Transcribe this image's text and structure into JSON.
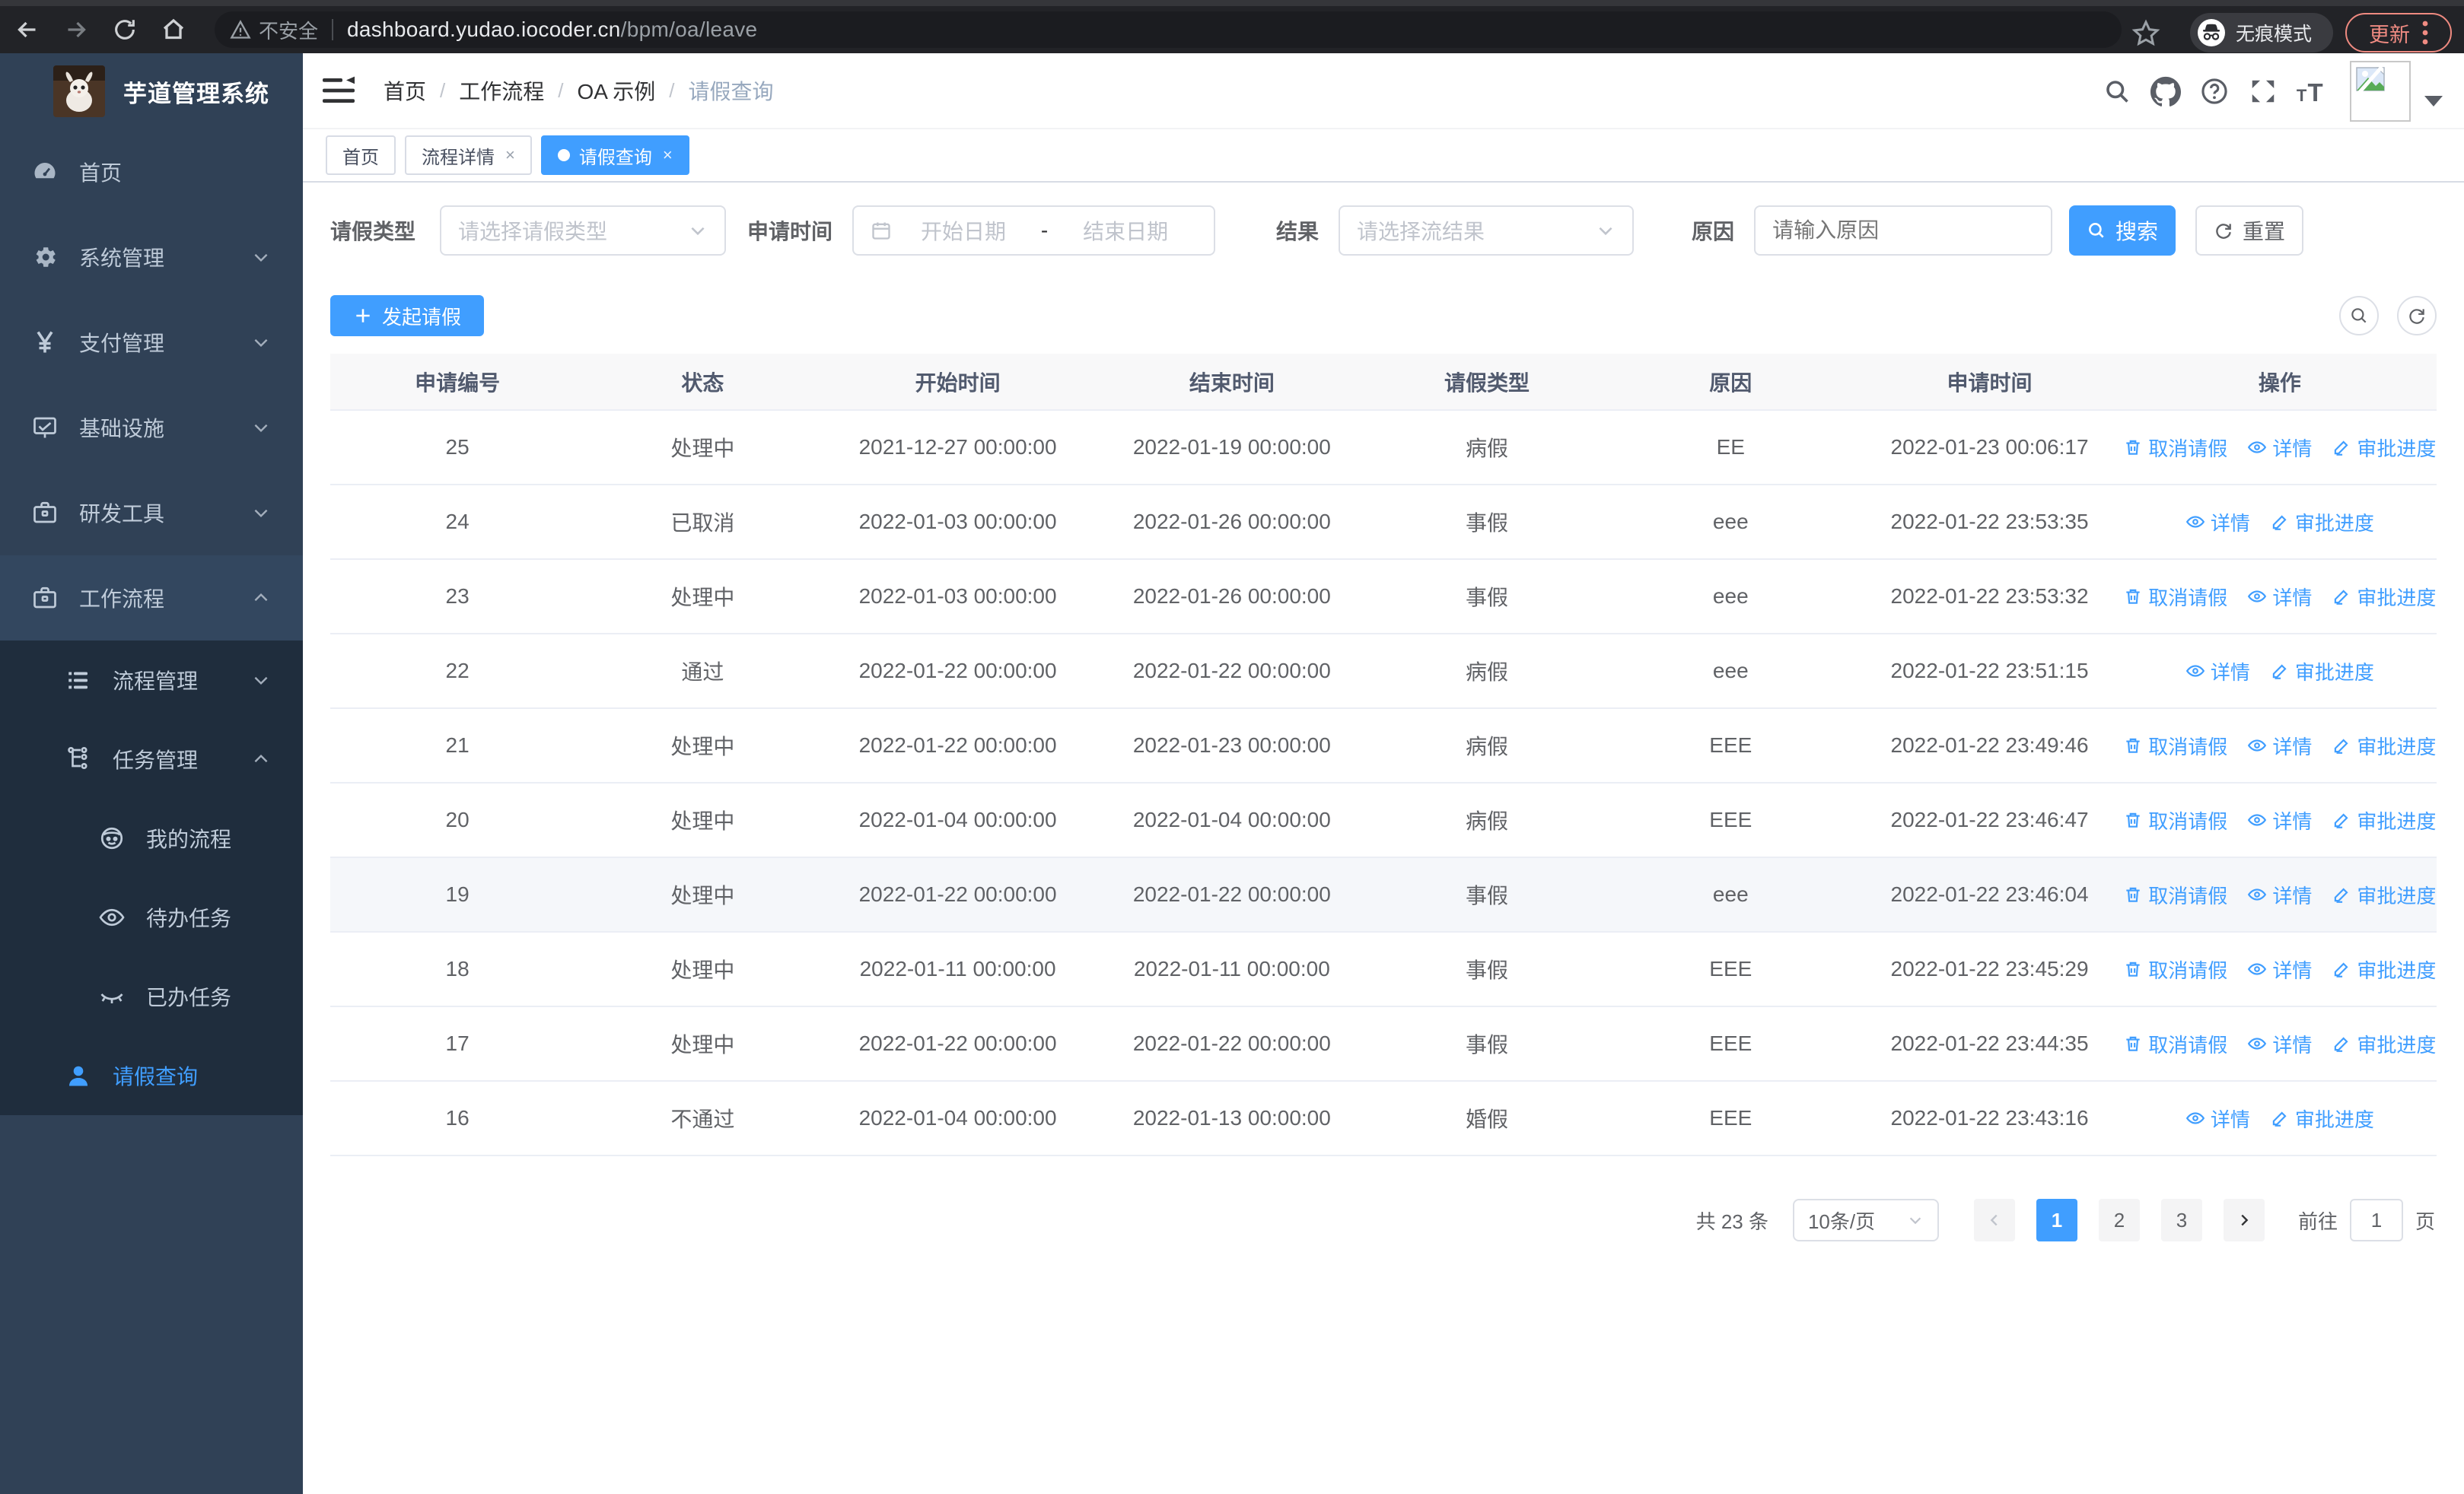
{
  "browser": {
    "security_label": "不安全",
    "url_domain": "dashboard.yudao.iocoder.cn",
    "url_path": "/bpm/oa/leave",
    "incognito_label": "无痕模式",
    "update_label": "更新"
  },
  "colors": {
    "accent": "#409eff",
    "sidebar_bg": "#304156",
    "submenu_bg": "#1f2d3d",
    "update_red": "#f08b82"
  },
  "sidebar": {
    "title": "芋道管理系统",
    "items": [
      {
        "name": "home",
        "icon": "dashboard-icon",
        "label": "首页",
        "level": 1
      },
      {
        "name": "system-management",
        "icon": "gear-icon",
        "label": "系统管理",
        "level": 1,
        "chevron": "down"
      },
      {
        "name": "payment-management",
        "icon": "yen-icon",
        "label": "支付管理",
        "level": 1,
        "chevron": "down"
      },
      {
        "name": "infrastructure",
        "icon": "monitor-icon",
        "label": "基础设施",
        "level": 1,
        "chevron": "down"
      },
      {
        "name": "dev-tools",
        "icon": "briefcase-icon",
        "label": "研发工具",
        "level": 1,
        "chevron": "down"
      },
      {
        "name": "workflow",
        "icon": "briefcase-icon",
        "label": "工作流程",
        "level": 1,
        "chevron": "up",
        "hovered": true
      },
      {
        "name": "process-management",
        "icon": "list-icon",
        "label": "流程管理",
        "level": 2,
        "chevron": "down",
        "dark": true
      },
      {
        "name": "task-management",
        "icon": "tree-icon",
        "label": "任务管理",
        "level": 2,
        "chevron": "up",
        "dark": true
      },
      {
        "name": "my-process",
        "icon": "robot-icon",
        "label": "我的流程",
        "level": 3,
        "dark": true
      },
      {
        "name": "todo-tasks",
        "icon": "eye-icon",
        "label": "待办任务",
        "level": 3,
        "dark": true
      },
      {
        "name": "done-tasks",
        "icon": "eye-closed-icon",
        "label": "已办任务",
        "level": 3,
        "dark": true
      },
      {
        "name": "leave-query",
        "icon": "user-icon",
        "label": "请假查询",
        "level": 2,
        "dark": true,
        "active": true
      }
    ]
  },
  "breadcrumb": [
    {
      "name": "home",
      "label": "首页"
    },
    {
      "name": "workflow",
      "label": "工作流程"
    },
    {
      "name": "oa-example",
      "label": "OA 示例"
    },
    {
      "name": "leave-query",
      "label": "请假查询",
      "current": true
    }
  ],
  "tabs": [
    {
      "name": "home",
      "label": "首页"
    },
    {
      "name": "process-detail",
      "label": "流程详情",
      "closable": true
    },
    {
      "name": "leave-query",
      "label": "请假查询",
      "closable": true,
      "active": true
    }
  ],
  "filters": {
    "leave_type_label": "请假类型",
    "leave_type_placeholder": "请选择请假类型",
    "apply_time_label": "申请时间",
    "date_start_placeholder": "开始日期",
    "date_separator": "-",
    "date_end_placeholder": "结束日期",
    "result_label": "结果",
    "result_placeholder": "请选择流结果",
    "reason_label": "原因",
    "reason_placeholder": "请输入原因",
    "search_label": "搜索",
    "reset_label": "重置"
  },
  "toolbar": {
    "create_label": "发起请假"
  },
  "table": {
    "columns": [
      "申请编号",
      "状态",
      "开始时间",
      "结束时间",
      "请假类型",
      "原因",
      "申请时间",
      "操作"
    ],
    "action_labels": {
      "cancel": "取消请假",
      "detail": "详情",
      "progress": "审批进度"
    },
    "rows": [
      {
        "id": "25",
        "status": "处理中",
        "start": "2021-12-27 00:00:00",
        "end": "2022-01-19 00:00:00",
        "type": "病假",
        "reason": "EE",
        "applied": "2022-01-23 00:06:17",
        "actions": [
          "cancel",
          "detail",
          "progress"
        ]
      },
      {
        "id": "24",
        "status": "已取消",
        "start": "2022-01-03 00:00:00",
        "end": "2022-01-26 00:00:00",
        "type": "事假",
        "reason": "eee",
        "applied": "2022-01-22 23:53:35",
        "actions": [
          "detail",
          "progress"
        ]
      },
      {
        "id": "23",
        "status": "处理中",
        "start": "2022-01-03 00:00:00",
        "end": "2022-01-26 00:00:00",
        "type": "事假",
        "reason": "eee",
        "applied": "2022-01-22 23:53:32",
        "actions": [
          "cancel",
          "detail",
          "progress"
        ]
      },
      {
        "id": "22",
        "status": "通过",
        "start": "2022-01-22 00:00:00",
        "end": "2022-01-22 00:00:00",
        "type": "病假",
        "reason": "eee",
        "applied": "2022-01-22 23:51:15",
        "actions": [
          "detail",
          "progress"
        ]
      },
      {
        "id": "21",
        "status": "处理中",
        "start": "2022-01-22 00:00:00",
        "end": "2022-01-23 00:00:00",
        "type": "病假",
        "reason": "EEE",
        "applied": "2022-01-22 23:49:46",
        "actions": [
          "cancel",
          "detail",
          "progress"
        ]
      },
      {
        "id": "20",
        "status": "处理中",
        "start": "2022-01-04 00:00:00",
        "end": "2022-01-04 00:00:00",
        "type": "病假",
        "reason": "EEE",
        "applied": "2022-01-22 23:46:47",
        "actions": [
          "cancel",
          "detail",
          "progress"
        ]
      },
      {
        "id": "19",
        "status": "处理中",
        "start": "2022-01-22 00:00:00",
        "end": "2022-01-22 00:00:00",
        "type": "事假",
        "reason": "eee",
        "applied": "2022-01-22 23:46:04",
        "actions": [
          "cancel",
          "detail",
          "progress"
        ],
        "highlight": true
      },
      {
        "id": "18",
        "status": "处理中",
        "start": "2022-01-11 00:00:00",
        "end": "2022-01-11 00:00:00",
        "type": "事假",
        "reason": "EEE",
        "applied": "2022-01-22 23:45:29",
        "actions": [
          "cancel",
          "detail",
          "progress"
        ]
      },
      {
        "id": "17",
        "status": "处理中",
        "start": "2022-01-22 00:00:00",
        "end": "2022-01-22 00:00:00",
        "type": "事假",
        "reason": "EEE",
        "applied": "2022-01-22 23:44:35",
        "actions": [
          "cancel",
          "detail",
          "progress"
        ]
      },
      {
        "id": "16",
        "status": "不通过",
        "start": "2022-01-04 00:00:00",
        "end": "2022-01-13 00:00:00",
        "type": "婚假",
        "reason": "EEE",
        "applied": "2022-01-22 23:43:16",
        "actions": [
          "detail",
          "progress"
        ]
      }
    ]
  },
  "pagination": {
    "total_label": "共 23 条",
    "page_size_label": "10条/页",
    "pages": [
      "1",
      "2",
      "3"
    ],
    "active_page": "1",
    "goto_label": "前往",
    "goto_value": "1",
    "goto_unit": "页"
  }
}
